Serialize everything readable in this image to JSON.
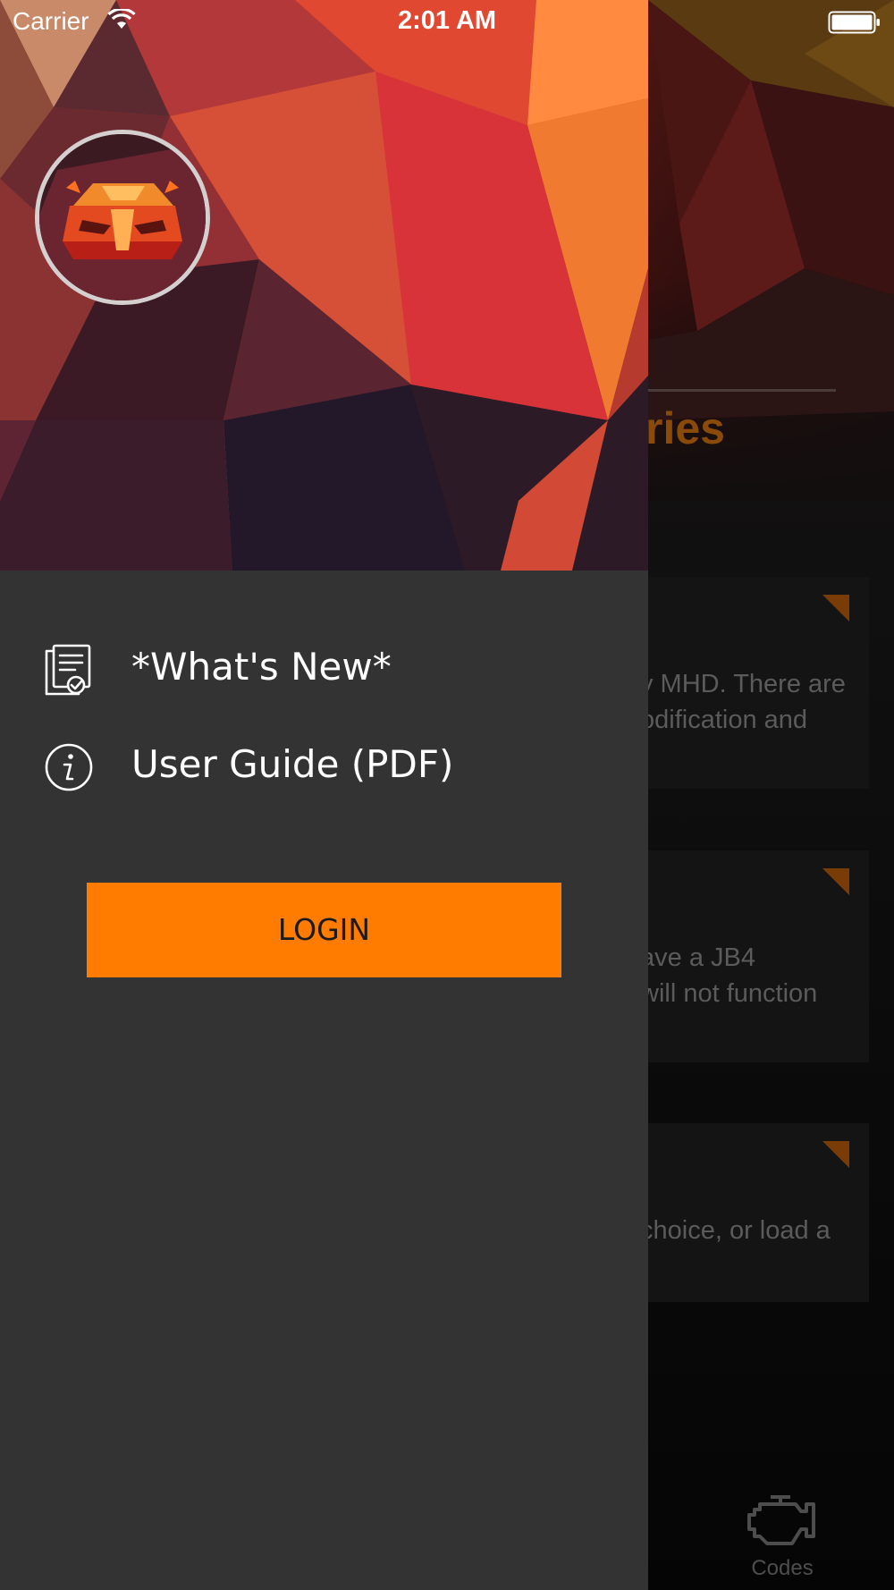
{
  "status_bar": {
    "carrier": "Carrier",
    "time": "2:01 AM",
    "icons": [
      "wifi-icon",
      "battery-icon"
    ]
  },
  "background_app": {
    "title_fragment": "ries",
    "cards": [
      {
        "lines": [
          "y MHD. There are",
          "odification and"
        ]
      },
      {
        "lines": [
          "ave a JB4",
          "will not function"
        ]
      },
      {
        "lines": [
          "choice, or load a"
        ]
      }
    ],
    "tab": {
      "label": "Codes",
      "icon": "engine-icon"
    }
  },
  "drawer": {
    "avatar_icon": "car-logo-icon",
    "menu": [
      {
        "label": "*What's New*",
        "icon": "document-check-icon"
      },
      {
        "label": "User Guide (PDF)",
        "icon": "info-icon"
      }
    ],
    "login_label": "LOGIN"
  },
  "colors": {
    "drawer_bg": "#333333",
    "accent": "#ff7c00",
    "text": "#ffffff"
  }
}
